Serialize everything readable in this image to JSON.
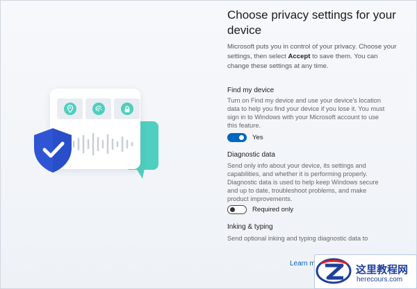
{
  "header": {
    "title": "Choose privacy settings for your device",
    "intro_before": "Microsoft puts you in control of your privacy. Choose your settings, then select ",
    "intro_bold": "Accept",
    "intro_after": " to save them. You can change these settings at any time."
  },
  "settings": [
    {
      "title": "Find my device",
      "description": "Turn on Find my device and use your device's location data to help you find your device if you lose it. You must sign in to Windows with your Microsoft account to use this feature.",
      "toggle_state": "on",
      "toggle_label": "Yes"
    },
    {
      "title": "Diagnostic data",
      "description": "Send only info about your device, its settings and capabilities, and whether it is performing properly. Diagnostic data is used to help keep Windows secure and up to date, troubleshoot problems, and make product improvements.",
      "toggle_state": "off",
      "toggle_label": "Required only"
    },
    {
      "title": "Inking & typing",
      "description": "Send optional inking and typing diagnostic data to"
    }
  ],
  "footer": {
    "learn_more": "Learn m"
  },
  "watermark": {
    "site_name": "这里教程网",
    "url": "herecours.com"
  },
  "icons": {
    "illustration_tiles": [
      "location-pin-icon",
      "fingerprint-icon",
      "lock-icon"
    ],
    "shield": "shield-check-icon"
  },
  "colors": {
    "accent": "#0067c0",
    "teal": "#4fcfbf",
    "shield": "#2f55d4"
  }
}
